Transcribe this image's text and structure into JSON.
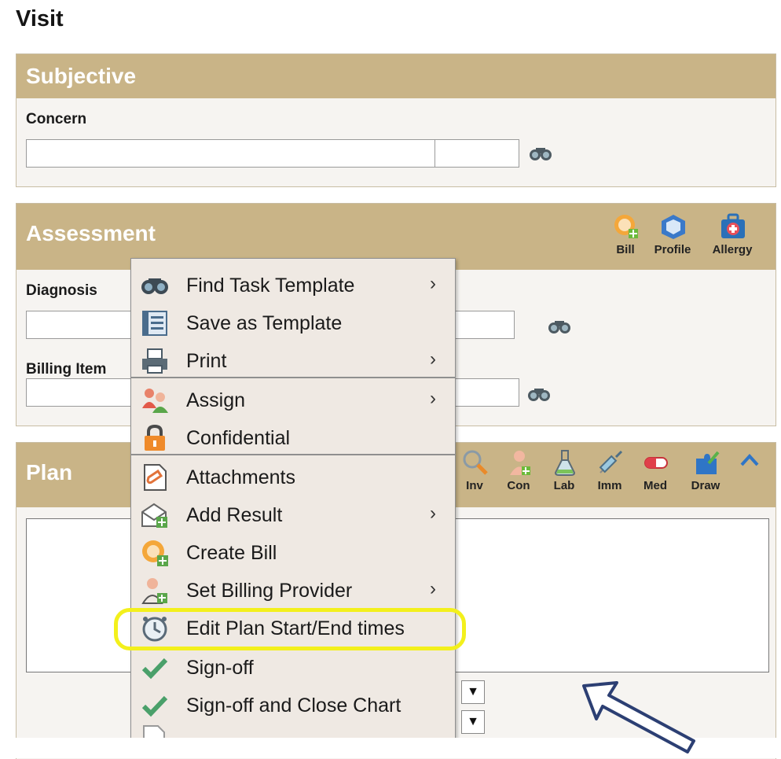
{
  "page": {
    "title": "Visit"
  },
  "subjective": {
    "title": "Subjective",
    "concern_label": "Concern",
    "concern_value": "",
    "concern_code_value": ""
  },
  "assessment": {
    "title": "Assessment",
    "toolbar": [
      "Bill",
      "Profile",
      "Allergy"
    ],
    "diagnosis_label": "Diagnosis",
    "billing_label": "Billing Item"
  },
  "plan": {
    "title": "Plan",
    "toolbar": [
      "Inv",
      "Con",
      "Lab",
      "Imm",
      "Med",
      "Draw"
    ]
  },
  "context_menu": {
    "items": [
      {
        "label": "Find Task Template",
        "icon": "binoculars-icon",
        "submenu": "›"
      },
      {
        "label": "Save as Template",
        "icon": "template-icon",
        "submenu": ""
      },
      {
        "label": "Print",
        "icon": "printer-icon",
        "submenu": "›"
      },
      {
        "label": "Assign",
        "icon": "people-icon",
        "submenu": "›"
      },
      {
        "label": "Confidential",
        "icon": "lock-icon",
        "submenu": ""
      },
      {
        "label": "Attachments",
        "icon": "attachment-icon",
        "submenu": ""
      },
      {
        "label": "Add Result",
        "icon": "add-result-icon",
        "submenu": "›"
      },
      {
        "label": "Create Bill",
        "icon": "create-bill-icon",
        "submenu": ""
      },
      {
        "label": "Set Billing Provider",
        "icon": "billing-provider-icon",
        "submenu": "›"
      },
      {
        "label": "Edit Plan Start/End times",
        "icon": "clock-icon",
        "submenu": ""
      },
      {
        "label": "Sign-off",
        "icon": "checkmark-icon",
        "submenu": ""
      },
      {
        "label": "Sign-off and Close Chart",
        "icon": "checkmark-icon",
        "submenu": ""
      }
    ]
  },
  "colors": {
    "section_header": "#c9b487",
    "menu_bg": "#efe9e3",
    "highlight": "#f3f01c",
    "arrow": "#2c3f73"
  }
}
